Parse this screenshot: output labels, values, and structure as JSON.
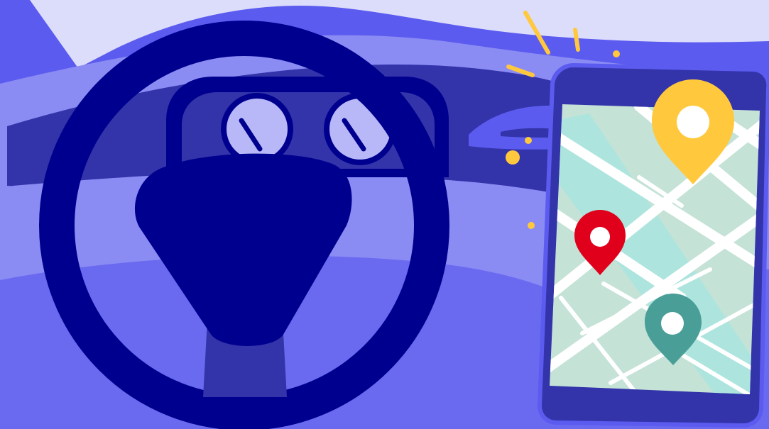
{
  "scene": {
    "subject": "car-dashboard-navigation-illustration",
    "colors": {
      "sky": "#dcdcfb",
      "windshield_frame": "#5b5bef",
      "dashboard_light": "#8b8bf4",
      "dashboard_mid": "#6a6af0",
      "dashboard_dark": "#3333aa",
      "steering_wheel": "#00008f",
      "gauge_face": "#b8b8f8",
      "phone_body": "#3333aa",
      "map_background": "#c4e2d6",
      "map_road": "#ffffff",
      "map_river": "#a8e6e0",
      "pin_yellow": "#ffc83d",
      "pin_red": "#e0001b",
      "pin_teal": "#4a9e98",
      "sparkle": "#ffc83d"
    },
    "pins": [
      {
        "name": "yellow-location-pin",
        "color": "#ffc83d"
      },
      {
        "name": "red-location-pin",
        "color": "#e0001b"
      },
      {
        "name": "teal-location-pin",
        "color": "#4a9e98"
      }
    ]
  }
}
